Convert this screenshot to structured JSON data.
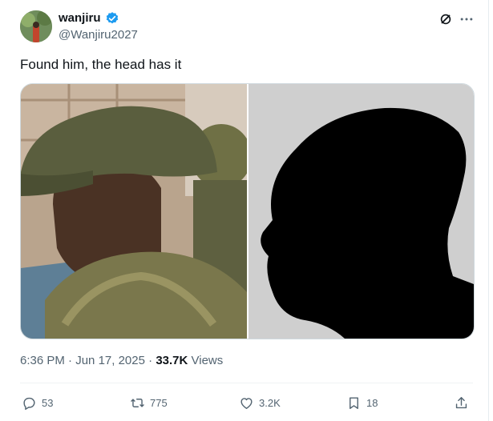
{
  "author": {
    "display_name": "wanjiru",
    "handle": "@Wanjiru2027"
  },
  "tweet": {
    "text": "Found him, the head has it"
  },
  "meta": {
    "time": "6:36 PM",
    "date": "Jun 17, 2025",
    "separator": "·",
    "views_count": "33.7K",
    "views_label": "Views"
  },
  "actions": {
    "replies": "53",
    "reposts": "775",
    "likes": "3.2K",
    "bookmarks": "18"
  },
  "icons": {
    "verified": "verified-badge-icon",
    "grok": "grok-icon",
    "more": "more-icon",
    "reply": "reply-icon",
    "repost": "repost-icon",
    "like": "heart-icon",
    "bookmark": "bookmark-icon",
    "share": "share-icon"
  },
  "colors": {
    "verified_blue": "#1d9bf0",
    "secondary_text": "#536471",
    "primary_text": "#0f1419"
  }
}
